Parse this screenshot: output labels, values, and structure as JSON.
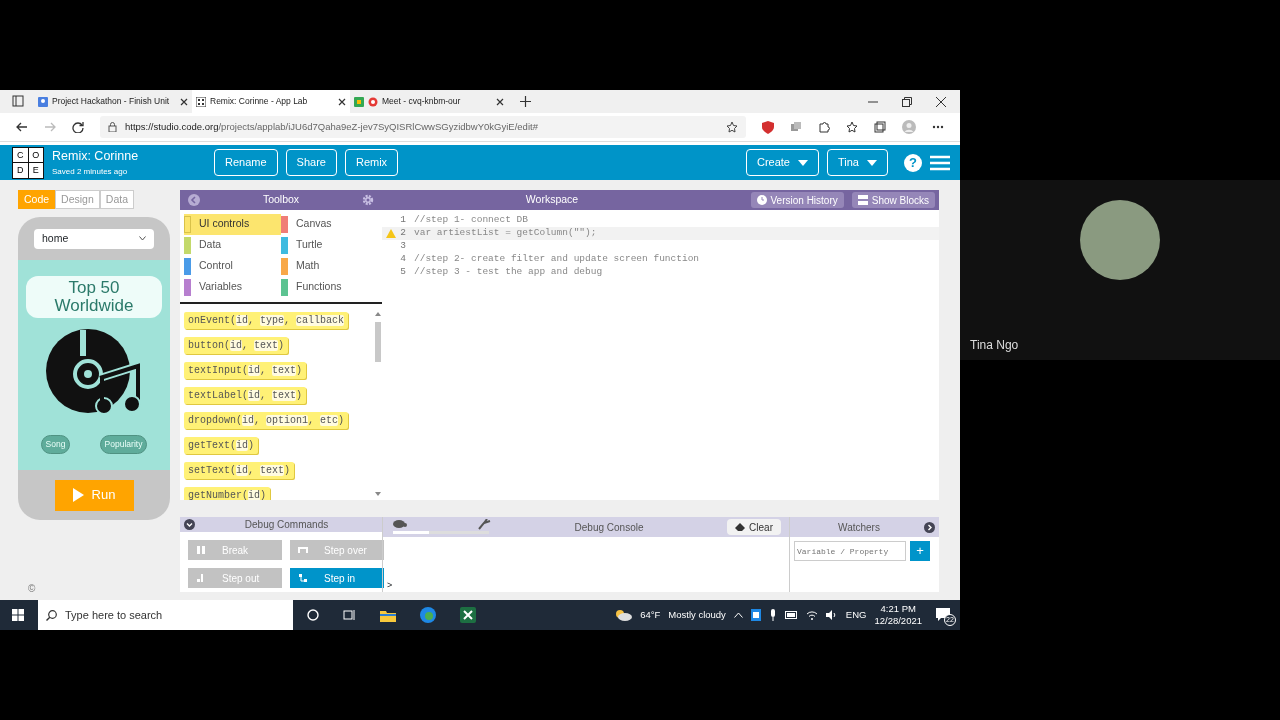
{
  "browser": {
    "tabs": [
      {
        "label": "Project Hackathon - Finish Unit",
        "selected": false
      },
      {
        "label": "Remix: Corinne - App Lab",
        "selected": true
      },
      {
        "label": "Meet - cvq-knbm-our",
        "selected": false
      }
    ],
    "address": {
      "host": "https://studio.code.org",
      "path": "/projects/applab/iJU6d7Qaha9eZ-jev7SyQISRlCwwSGyzidbwY0kGyiE/edit#"
    }
  },
  "app_header": {
    "logo_letters": [
      "C",
      "O",
      "D",
      "E"
    ],
    "title": "Remix: Corinne",
    "subtitle": "Saved 2 minutes ago",
    "buttons": [
      "Rename",
      "Share",
      "Remix"
    ],
    "menus": [
      "Create",
      "Tina"
    ],
    "help": "?"
  },
  "mode_tabs": [
    {
      "label": "Code",
      "selected": true
    },
    {
      "label": "Design",
      "selected": false
    },
    {
      "label": "Data",
      "selected": false
    }
  ],
  "phone": {
    "screen_select": "home",
    "title": "Top 50 Worldwide",
    "buttons": [
      "Song",
      "Popularity"
    ],
    "run": "Run"
  },
  "toolbox": {
    "title": "Toolbox",
    "categories": [
      {
        "label": "UI controls",
        "color": "#fce56e",
        "selected": true
      },
      {
        "label": "Canvas",
        "color": "#f07d76",
        "selected": false
      },
      {
        "label": "Data",
        "color": "#c3d96b",
        "selected": false
      },
      {
        "label": "Turtle",
        "color": "#3fbbe0",
        "selected": false
      },
      {
        "label": "Control",
        "color": "#4a9be8",
        "selected": false
      },
      {
        "label": "Math",
        "color": "#f8a848",
        "selected": false
      },
      {
        "label": "Variables",
        "color": "#b77fcf",
        "selected": false
      },
      {
        "label": "Functions",
        "color": "#5cc391",
        "selected": false
      }
    ],
    "blocks": [
      {
        "segments": [
          "onEvent(",
          "id",
          ", ",
          "type",
          ", ",
          "callback"
        ]
      },
      {
        "segments": [
          "button(",
          "id",
          ", ",
          "text",
          ")"
        ]
      },
      {
        "segments": [
          "textInput(",
          "id",
          ", ",
          "text",
          ")"
        ]
      },
      {
        "segments": [
          "textLabel(",
          "id",
          ", ",
          "text",
          ")"
        ]
      },
      {
        "segments": [
          "dropdown(",
          "id",
          ", ",
          "option1",
          ", ",
          "etc",
          ")"
        ]
      },
      {
        "segments": [
          "getText(",
          "id",
          ")"
        ]
      },
      {
        "segments": [
          "setText(",
          "id",
          ", ",
          "text",
          ")"
        ]
      },
      {
        "segments": [
          "getNumber(",
          "id",
          ")"
        ]
      }
    ]
  },
  "workspace": {
    "title": "Workspace",
    "buttons": [
      "Version History",
      "Show Blocks"
    ],
    "lines": [
      {
        "number": "1",
        "text": "//step 1- connect DB",
        "warning": false,
        "active": false
      },
      {
        "number": "2",
        "text": "var artiestList = getColumn(\"\");",
        "warning": true,
        "active": true
      },
      {
        "number": "3",
        "warning": false,
        "active": false
      },
      {
        "number": "4",
        "text": "//step 2- create filter and update screen function",
        "warning": false,
        "active": false
      },
      {
        "number": "5",
        "text": "//step 3 - test the app and debug",
        "warning": false,
        "active": false
      }
    ]
  },
  "debug": {
    "commands_title": "Debug Commands",
    "commands": [
      {
        "label": "Break",
        "disabled": true
      },
      {
        "label": "Step over",
        "disabled": true
      },
      {
        "label": "Step out",
        "disabled": true
      },
      {
        "label": "Step in",
        "disabled": false
      }
    ],
    "console_title": "Debug Console",
    "speed": {
      "level": 0.38
    },
    "clear": "Clear",
    "prompt": ">",
    "watchers_title": "Watchers",
    "watch_field": {
      "placeholder": "Variable / Property"
    },
    "add": "+"
  },
  "footer": "©",
  "taskbar": {
    "search": {
      "placeholder": "Type here to search"
    },
    "temperature": "64°F",
    "weather": "Mostly cloudy",
    "language": "ENG",
    "time": "4:21 PM",
    "date": "12/28/2021",
    "notifications": "22"
  },
  "video_tile": {
    "name": "Tina Ngo"
  }
}
